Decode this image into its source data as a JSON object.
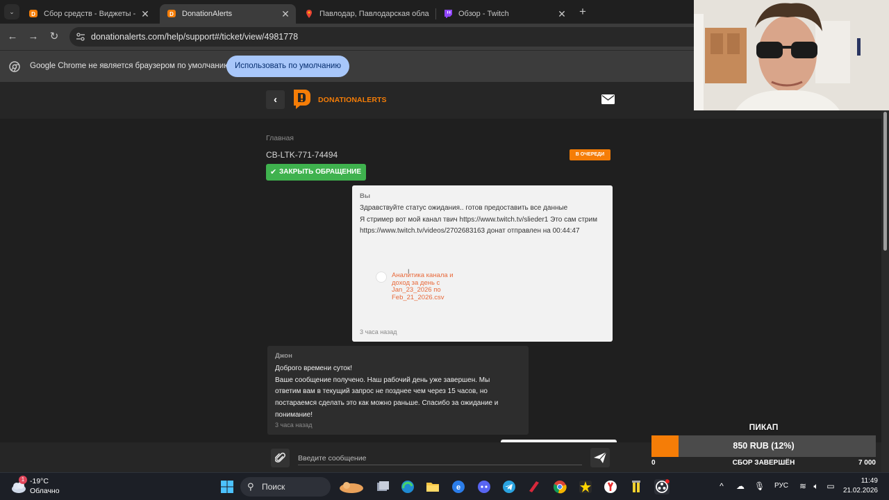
{
  "browser": {
    "tabs": [
      {
        "title": "Сбор средств - Виджеты - Don",
        "active": false
      },
      {
        "title": "DonationAlerts",
        "active": true
      },
      {
        "title": "Павлодар, Павлодарская обла",
        "active": false
      },
      {
        "title": "Обзор - Twitch",
        "active": false
      }
    ],
    "url": "donationalerts.com/help/support#/ticket/view/4981778",
    "infobar": {
      "text": "Google Chrome не является браузером по умолчанию.",
      "button": "Использовать по умолчанию"
    }
  },
  "site": {
    "logo_text": "DONATIONALERTS",
    "brand_color": "#f57d07",
    "breadcrumb": "Главная",
    "ticket_id": "CB-LTK-771-74494",
    "status": "В ОЧЕРЕДИ",
    "close_button": "ЗАКРЫТЬ ОБРАЩЕНИЕ",
    "messages": [
      {
        "author": "Вы",
        "lines": [
          "Здравствуйте статус ожидания.. готов предоставить все данные",
          "Я стример вот мой канал твич https://www.twitch.tv/slieder1 Это сам стрим https://www.twitch.tv/videos/2702683163 донат отправлен на 00:44:47"
        ],
        "attachment": "Аналитика канала и доход за день с Jan_23_2026 по Feb_21_2026.csv",
        "time": "3 часа назад"
      },
      {
        "author": "Джон",
        "lines": [
          "Доброго времени суток!",
          "Ваше сообщение получено. Наш рабочий день уже завершен. Мы ответим вам в текущий запрос не позднее чем через 15 часов, но постараемся сделать это как можно раньше. Спасибо за ожидание и понимание!"
        ],
        "time": "3 часа назад"
      }
    ],
    "composer_placeholder": "Введите сообщение"
  },
  "goal_widget": {
    "title": "ПИКАП",
    "value_text": "850 RUB (12%)",
    "progress": 0.12,
    "min": "0",
    "status": "СБОР ЗАВЕРШЁН",
    "max": "7 000"
  },
  "taskbar": {
    "weather_badge": "1",
    "weather_temp": "-19°C",
    "weather_cond": "Облачно",
    "search": "Поиск",
    "lang": "РУС",
    "time": "11:49",
    "date": "21.02.2026"
  }
}
